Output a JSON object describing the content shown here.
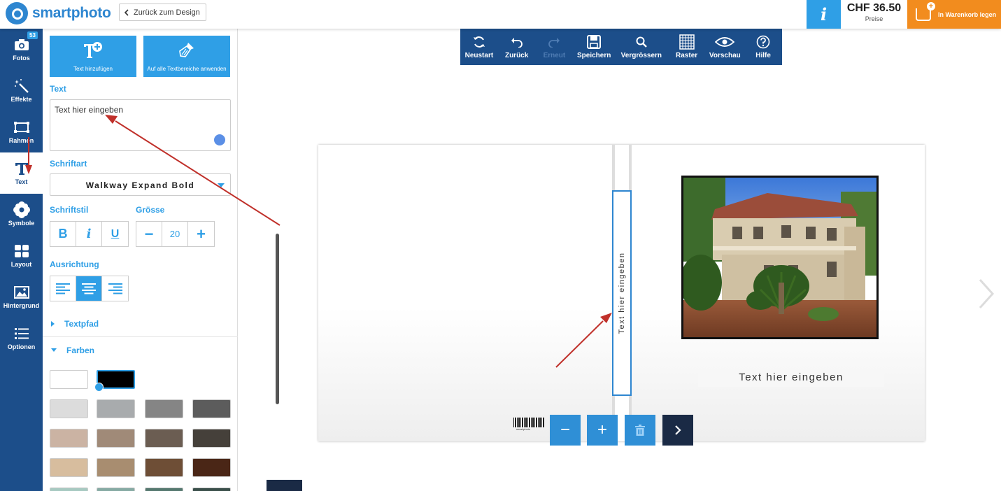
{
  "header": {
    "brand": "smartphoto",
    "back_label": "Zurück zum Design",
    "info_symbol": "i",
    "price": "CHF 36.50",
    "price_label": "Preise",
    "cart_label": "In Warenkorb legen",
    "colors": {
      "brand_blue": "#2e86d0",
      "info_blue": "#2f9fe6",
      "cart_orange": "#f28c1e"
    }
  },
  "nav": {
    "items": [
      {
        "label": "Fotos",
        "icon": "camera-icon",
        "badge": "53"
      },
      {
        "label": "Effekte",
        "icon": "magic-wand-icon"
      },
      {
        "label": "Rahmen",
        "icon": "frame-icon"
      },
      {
        "label": "Text",
        "icon": "text-icon",
        "active": true
      },
      {
        "label": "Symbole",
        "icon": "flower-icon"
      },
      {
        "label": "Layout",
        "icon": "layout-icon"
      },
      {
        "label": "Hintergrund",
        "icon": "image-icon"
      },
      {
        "label": "Optionen",
        "icon": "options-icon"
      }
    ],
    "colors": {
      "background": "#1c4e8a"
    }
  },
  "panel": {
    "add_text_label": "Text hinzufügen",
    "apply_all_label": "Auf alle Textbereiche anwenden",
    "text_label": "Text",
    "text_value": "Text hier eingeben",
    "font_label": "Schriftart",
    "font_value": "Walkway Expand Bold",
    "style_label": "Schriftstil",
    "style_buttons": [
      "B",
      "i",
      "U"
    ],
    "size_label": "Grösse",
    "size_value": "20",
    "size_minus": "−",
    "size_plus": "+",
    "align_label": "Ausrichtung",
    "align_active": "center",
    "textpath_label": "Textpfad",
    "colors_label": "Farben",
    "color_swatches": [
      "#ffffff",
      "#000000",
      "#dcdcdc",
      "#a8abad",
      "#858585",
      "#5c5c5c",
      "#cbb3a3",
      "#a08a78",
      "#6b5d52",
      "#45403a",
      "#d7bd9e",
      "#a88d70",
      "#6e4e36",
      "#4a2616",
      "#a7c9c1",
      "#86aaa3",
      "#55786f",
      "#3a4f4a"
    ],
    "selected_swatch": "#000000"
  },
  "toolbar": {
    "items": [
      {
        "label": "Neustart",
        "icon": "refresh-icon"
      },
      {
        "label": "Zurück",
        "icon": "undo-icon"
      },
      {
        "label": "Erneut",
        "icon": "redo-icon",
        "disabled": true
      },
      {
        "label": "Speichern",
        "icon": "save-icon"
      },
      {
        "label": "Vergrössern",
        "icon": "zoom-icon"
      },
      {
        "label": "Raster",
        "icon": "grid-icon"
      },
      {
        "label": "Vorschau",
        "icon": "eye-icon"
      },
      {
        "label": "Hilfe",
        "icon": "help-icon"
      }
    ]
  },
  "canvas": {
    "spine_text": "Text hier eingeben",
    "cover_text": "Text hier eingeben",
    "barcode_caption": "smartphoto",
    "controls": [
      {
        "symbol": "−",
        "icon": "zoom-out-icon",
        "color": "#2f8fd6"
      },
      {
        "symbol": "+",
        "icon": "zoom-in-icon",
        "color": "#2f8fd6"
      },
      {
        "symbol": "",
        "icon": "trash-icon",
        "color": "#2f8fd6"
      },
      {
        "symbol": "›",
        "icon": "chevron-right-icon",
        "color": "#1a2a45"
      }
    ],
    "annotation_color": "#c0302a"
  }
}
